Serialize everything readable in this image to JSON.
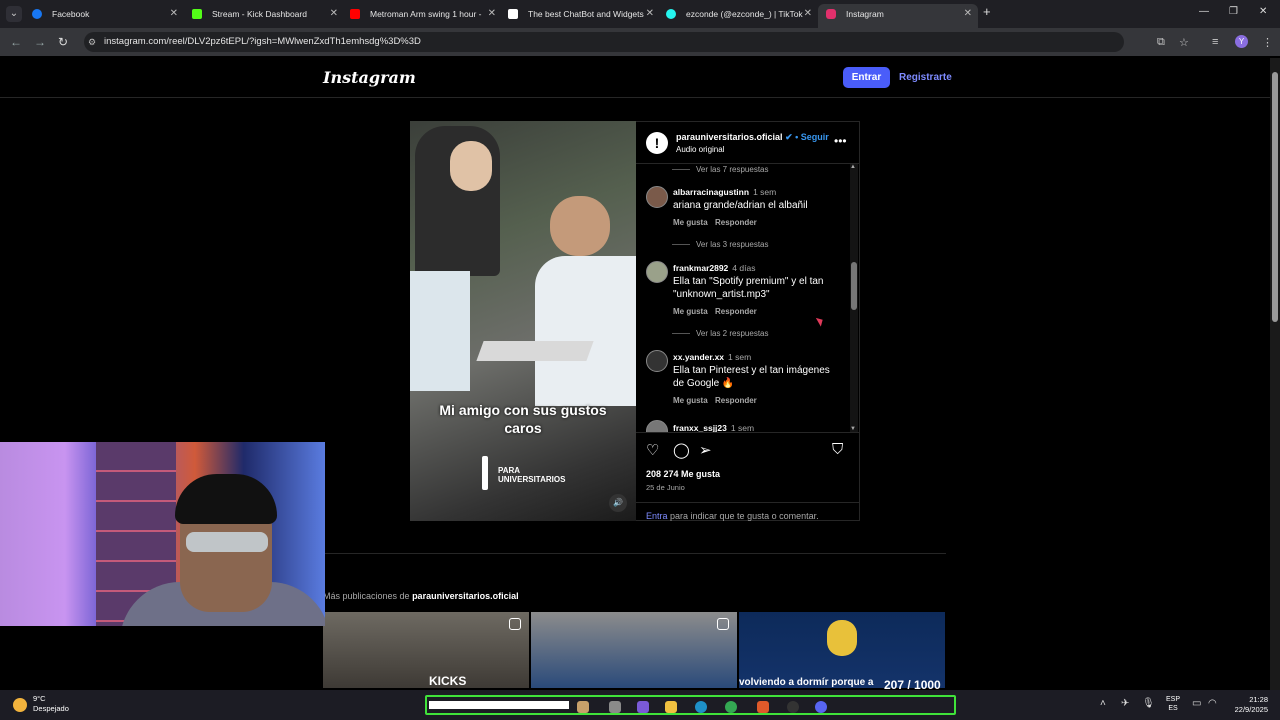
{
  "browser": {
    "tabs": [
      {
        "title": "Facebook",
        "favicon": "facebook-icon",
        "color": "#1877f2"
      },
      {
        "title": "Stream - Kick Dashboard",
        "favicon": "kick-icon",
        "color": "#53fc18"
      },
      {
        "title": "Metroman Arm swing 1 hour -",
        "favicon": "youtube-icon",
        "color": "#ff0000"
      },
      {
        "title": "The best ChatBot and Widgets",
        "favicon": "chatbot-icon",
        "color": "#ffffff"
      },
      {
        "title": "ezconde (@ezconde_) | TikTok",
        "favicon": "tiktok-icon",
        "color": "#25f4ee"
      },
      {
        "title": "Instagram",
        "favicon": "instagram-icon",
        "color": "#e1306c"
      }
    ],
    "url": "instagram.com/reel/DLV2pz6tEPL/?igsh=MWlwenZxdTh1emhsdg%3D%3D"
  },
  "ig": {
    "logo": "Instagram",
    "login_label": "Entrar",
    "signup_label": "Registrarte",
    "accent": "#4a5df9"
  },
  "video": {
    "subtitle_line1": "Mi amigo con sus gustos",
    "subtitle_line2": "caros",
    "brand_line1": "PARA",
    "brand_line2": "UNIVERSITARIOS"
  },
  "post": {
    "username": "parauniversitarios.oficial",
    "verified": "✔",
    "follow_label": "• Seguir",
    "audio": "Audio original",
    "likes": "208 274 Me gusta",
    "date": "25 de Junio",
    "login_link": "Entra",
    "login_text": " para indicar que te gusta o comentar."
  },
  "comments": {
    "replies_top": "Ver las 7 respuestas",
    "items": [
      {
        "user": "albarracinagustinn",
        "time": "1 sem",
        "text": "ariana grande/adrian el albañil",
        "like": "Me gusta",
        "reply": "Responder",
        "replies": "Ver las 3 respuestas"
      },
      {
        "user": "frankmar2892",
        "time": "4 días",
        "text": "Ella tan \"Spotify premium\" y el tan \"unknown_artist.mp3\"",
        "like": "Me gusta",
        "reply": "Responder",
        "replies": "Ver las 2 respuestas"
      },
      {
        "user": "xx.yander.xx",
        "time": "1 sem",
        "text": "Ella tan Pinterest y el tan imágenes de Google 🔥",
        "like": "Me gusta",
        "reply": "Responder"
      },
      {
        "user": "franxx_ssjj23",
        "time": "1 sem"
      }
    ]
  },
  "more": {
    "prefix": "Más publicaciones de ",
    "user": "parauniversitarios.oficial",
    "thumb1_label": "KICKS",
    "thumb3_label": "volviendo a dormír porque a",
    "thumb3_overlay": "207 / 1000"
  },
  "taskbar": {
    "temp": "9°C",
    "weather": "Despejado",
    "lang_line1": "ESP",
    "lang_line2": "ES",
    "time": "21:28",
    "date": "22/9/2025"
  }
}
